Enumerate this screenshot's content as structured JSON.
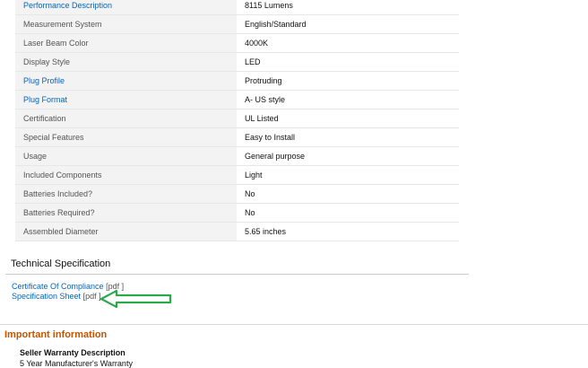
{
  "specs": [
    {
      "label": "Performance Description",
      "value": "8115 Lumens",
      "link": true
    },
    {
      "label": "Measurement System",
      "value": "English/Standard",
      "link": false
    },
    {
      "label": "Laser Beam Color",
      "value": "4000K",
      "link": false
    },
    {
      "label": "Display Style",
      "value": "LED",
      "link": false
    },
    {
      "label": "Plug Profile",
      "value": "Protruding",
      "link": true
    },
    {
      "label": "Plug Format",
      "value": "A- US style",
      "link": true
    },
    {
      "label": "Certification",
      "value": "UL Listed",
      "link": false
    },
    {
      "label": "Special Features",
      "value": "Easy to Install",
      "link": false
    },
    {
      "label": "Usage",
      "value": "General purpose",
      "link": false
    },
    {
      "label": "Included Components",
      "value": "Light",
      "link": false
    },
    {
      "label": "Batteries Included?",
      "value": "No",
      "link": false
    },
    {
      "label": "Batteries Required?",
      "value": "No",
      "link": false
    },
    {
      "label": "Assembled Diameter",
      "value": "5.65 inches",
      "link": false
    }
  ],
  "technical": {
    "heading": "Technical Specification",
    "documents": [
      {
        "name": "Certificate Of Compliance",
        "type": "[pdf ]"
      },
      {
        "name": "Specification Sheet",
        "type": "[pdf ]"
      }
    ]
  },
  "important": {
    "heading": "Important information",
    "warranty_heading": "Seller Warranty Description",
    "warranty_text": "5 Year Manufacturer's Warranty"
  },
  "colors": {
    "link": "#0066c0",
    "important_heading": "#c45500",
    "arrow": "#2aa84a",
    "label_background": "#f3f3f3"
  },
  "icons": {
    "annotation": "left-arrow-icon"
  }
}
